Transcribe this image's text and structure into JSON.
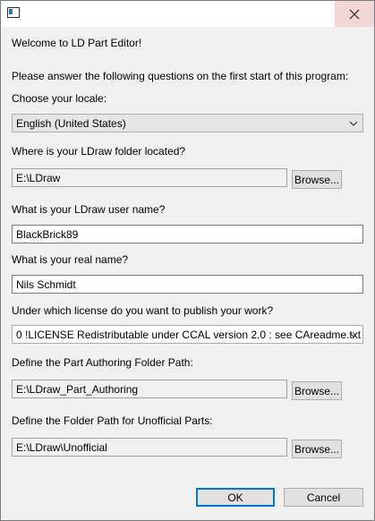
{
  "dialog": {
    "welcome": "Welcome to LD Part Editor!",
    "intro": "Please answer the following questions on the first start of this program:"
  },
  "locale": {
    "label": "Choose your locale:",
    "value": "English (United States)"
  },
  "ldraw_folder": {
    "label": "Where is your LDraw folder located?",
    "value": "E:\\LDraw",
    "browse": "Browse..."
  },
  "user_name": {
    "label": "What is your LDraw user name?",
    "value": "BlackBrick89"
  },
  "real_name": {
    "label": "What is your real name?",
    "value": "Nils Schmidt"
  },
  "license": {
    "label": "Under which license do you want to publish your work?",
    "value": "0 !LICENSE Redistributable under CCAL version 2.0 : see CAreadme.txt"
  },
  "authoring_folder": {
    "label": "Define the Part Authoring Folder Path:",
    "value": "E:\\LDraw_Part_Authoring",
    "browse": "Browse..."
  },
  "unofficial_folder": {
    "label": "Define the Folder Path for Unofficial Parts:",
    "value": "E:\\LDraw\\Unofficial",
    "browse": "Browse..."
  },
  "buttons": {
    "ok": "OK",
    "cancel": "Cancel"
  },
  "icons": {
    "app": "app-window-icon",
    "close": "close-icon",
    "dropdown": "chevron-down-icon"
  },
  "colors": {
    "accent": "#0078d7",
    "close_hover": "#f3d6d6"
  }
}
